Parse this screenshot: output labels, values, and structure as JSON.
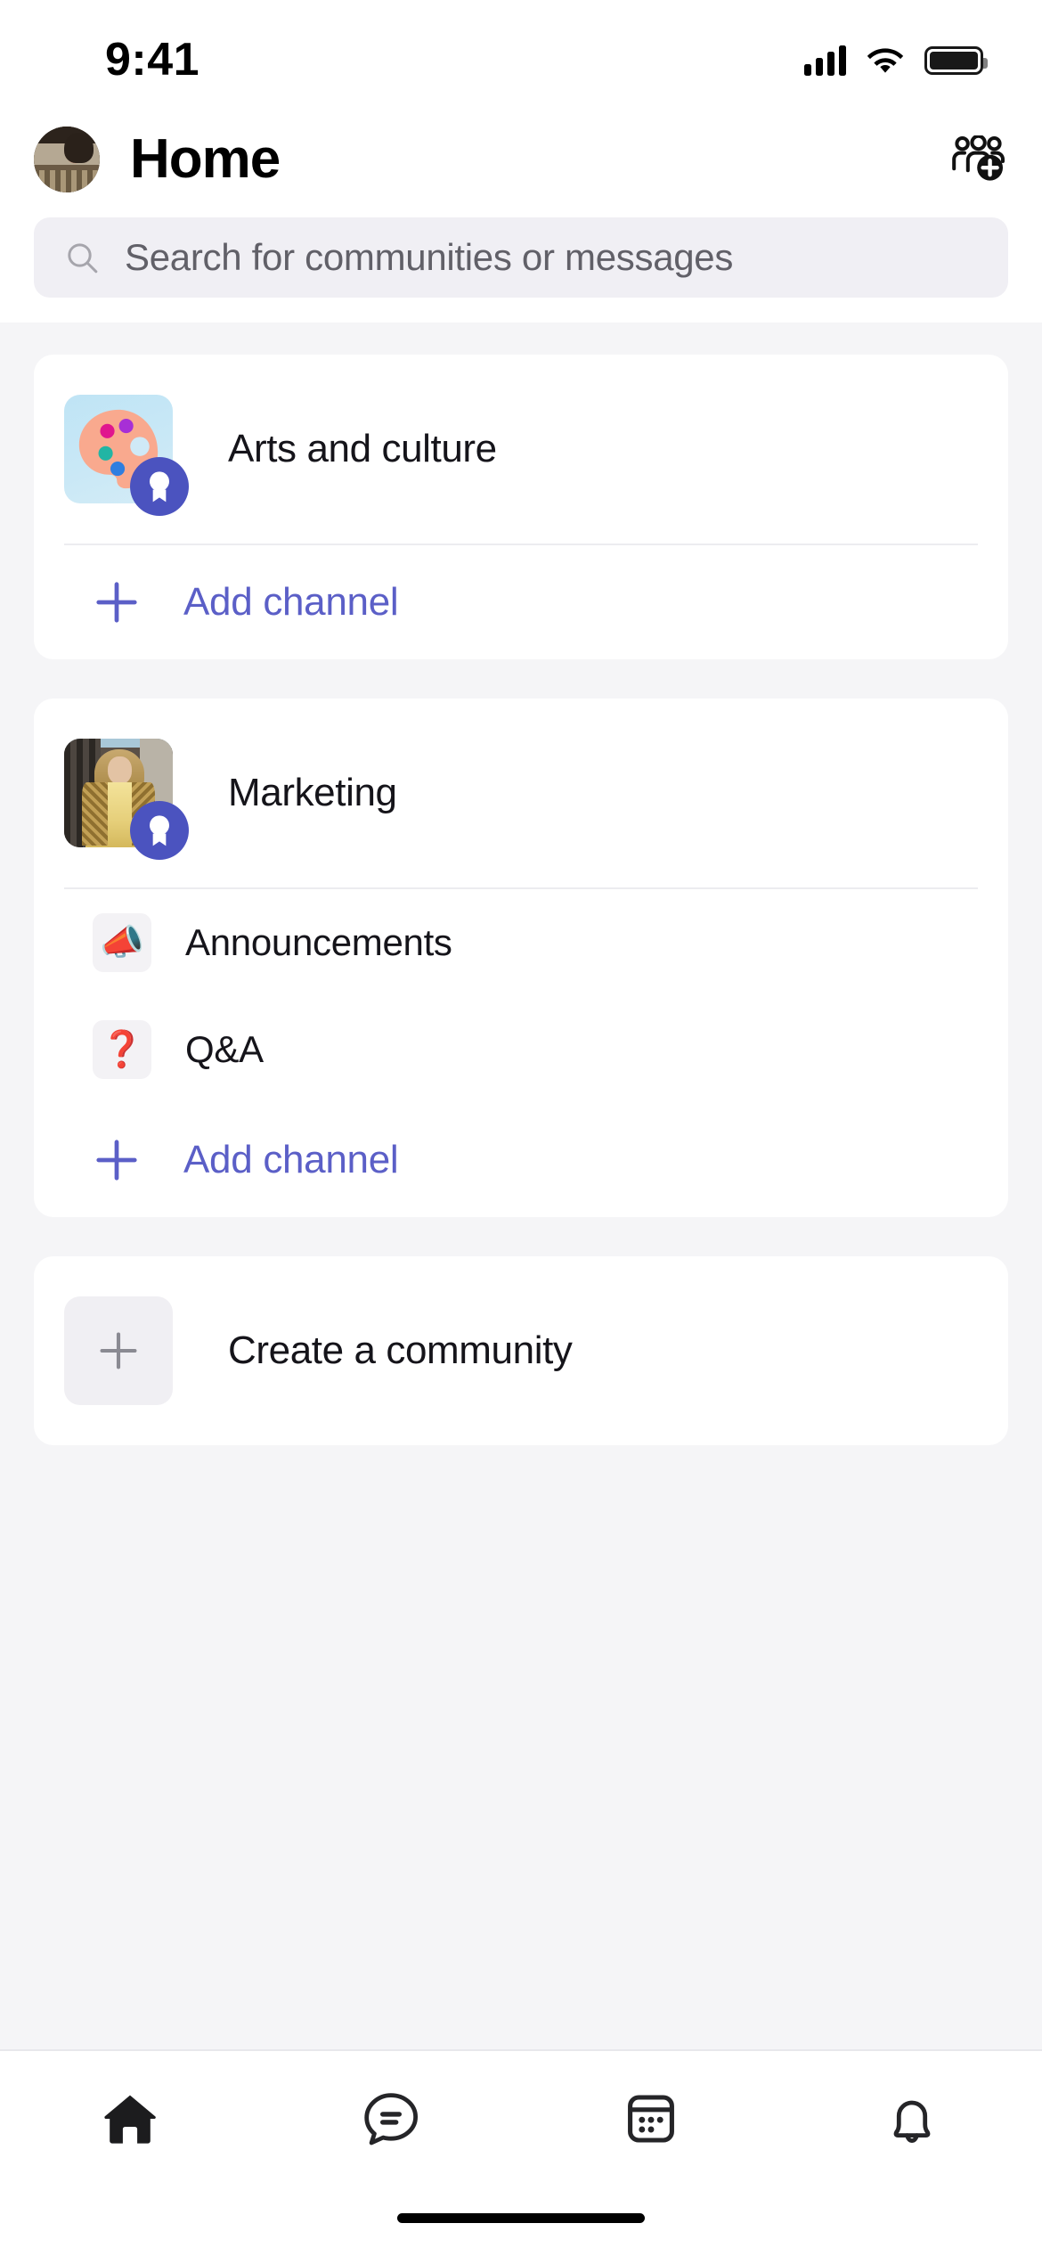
{
  "status_bar": {
    "time": "9:41",
    "cellular_icon": "cellular-signal-icon",
    "wifi_icon": "wifi-icon",
    "battery_icon": "battery-full-icon"
  },
  "header": {
    "title": "Home",
    "avatar_name": "user-avatar",
    "action_icon": "add-people-icon"
  },
  "search": {
    "placeholder": "Search for communities or messages",
    "icon": "search-icon"
  },
  "colors": {
    "accent_purple": "#5b5fc7",
    "badge_purple": "#4b53bf",
    "page_background": "#f5f5f7",
    "card_background": "#ffffff",
    "search_background": "#f0eff4",
    "primary_text": "#15141a",
    "placeholder_text": "#616068"
  },
  "communities": [
    {
      "name": "Arts and culture",
      "avatar_type": "art-palette-image",
      "badge": "community-owner-badge",
      "channels": [],
      "add_channel_label": "Add channel",
      "add_channel_icon": "plus-icon"
    },
    {
      "name": "Marketing",
      "avatar_type": "fashion-photo",
      "badge": "community-owner-badge",
      "channels": [
        {
          "name": "Announcements",
          "icon": "megaphone-emoji",
          "emoji": "📣"
        },
        {
          "name": "Q&A",
          "icon": "question-mark-emoji",
          "emoji": "❓"
        }
      ],
      "add_channel_label": "Add channel",
      "add_channel_icon": "plus-icon"
    }
  ],
  "create_community": {
    "label": "Create a community",
    "icon": "plus-icon"
  },
  "tab_bar": {
    "tabs": [
      {
        "name": "home",
        "icon": "home-icon",
        "active": true
      },
      {
        "name": "chat",
        "icon": "chat-bubble-icon",
        "active": false
      },
      {
        "name": "calendar",
        "icon": "calendar-icon",
        "active": false
      },
      {
        "name": "activity",
        "icon": "bell-icon",
        "active": false
      }
    ]
  },
  "home_indicator": "home-indicator-bar"
}
